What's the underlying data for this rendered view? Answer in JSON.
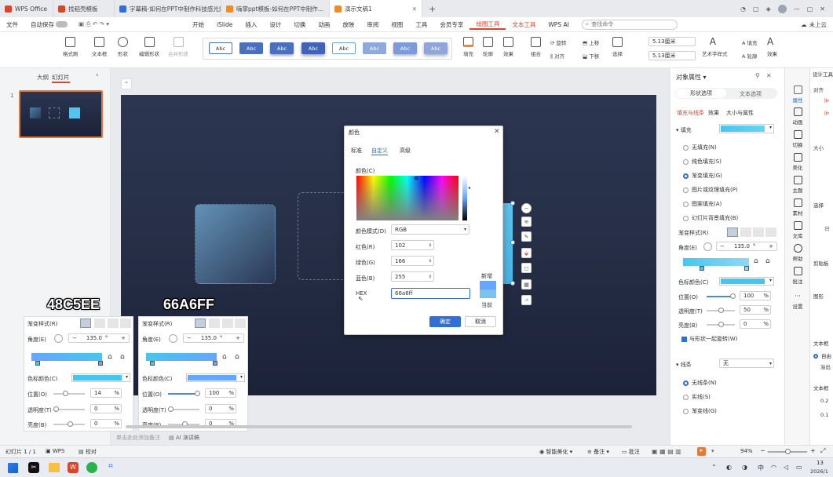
{
  "tabs": [
    {
      "label": "WPS Office",
      "color": "#d9472b"
    },
    {
      "label": "找稻壳模板",
      "color": "#d9472b"
    },
    {
      "label": "字幕稿-如何在PPT中制作科技感光效",
      "color": "#2f6fd6"
    },
    {
      "label": "嗨掌ppt模板-如何在PPT中制作...",
      "color": "#f08a24"
    },
    {
      "label": "演示文稿1",
      "color": "#f08a24"
    }
  ],
  "window": {
    "user": "未上云",
    "add_tab": "+"
  },
  "menubar": {
    "file": "文件",
    "autosave": "自动保存",
    "items": [
      "开始",
      "iSlide",
      "插入",
      "设计",
      "切换",
      "动画",
      "放映",
      "审阅",
      "视图",
      "工具",
      "会员专享",
      "绘图工具",
      "文本工具",
      "WPS AI"
    ],
    "search_placeholder": "查找命令"
  },
  "ribbon": {
    "format_brush": "格式刷",
    "textbox": "文本框",
    "shape": "形状",
    "edit_shape": "编辑形状",
    "merge_shape": "合并形状",
    "style_samples": [
      "Abc",
      "Abc",
      "Abc",
      "Abc",
      "Abc",
      "Abc",
      "Abc",
      "Abc"
    ],
    "fill": "填充",
    "outline": "轮廓",
    "effects": "效果",
    "group": "组合",
    "rotate": "旋转",
    "align": "对齐",
    "up": "上移",
    "down": "下移",
    "select": "选择",
    "height": "5.13厘米",
    "width": "5.13厘米",
    "art_style": "艺术字样式",
    "fill2": "填充",
    "outline2": "轮廓",
    "effects2": "效果"
  },
  "left_panel": {
    "outline_tab": "大纲",
    "slides_tab": "幻灯片",
    "slide_number": "1"
  },
  "overlay": {
    "label_a": "48C5EE",
    "label_b": "66A6FF"
  },
  "grad_panel_a": {
    "style": "渐变样式(R)",
    "angle_label": "角度(E)",
    "angle": "135.0",
    "unit": "°",
    "stop_color_label": "色标颜色(C)",
    "position_label": "位置(O)",
    "position": "14",
    "transparency_label": "透明度(T)",
    "transparency": "0",
    "brightness_label": "亮度(B)",
    "brightness": "0",
    "percent": "%",
    "minus": "−",
    "plus": "+"
  },
  "grad_panel_b": {
    "style": "渐变样式(R)",
    "angle_label": "角度(E)",
    "angle": "135.0",
    "unit": "°",
    "stop_color_label": "色标颜色(C)",
    "position_label": "位置(O)",
    "position": "100",
    "transparency_label": "透明度(T)",
    "transparency": "0",
    "brightness_label": "亮度(B)",
    "brightness": "0",
    "percent": "%",
    "minus": "−",
    "plus": "+"
  },
  "dialog": {
    "title": "颜色",
    "tabs": [
      "标准",
      "自定义",
      "高级"
    ],
    "color_label": "颜色(C)",
    "mode_label": "颜色模式(D)",
    "mode_value": "RGB",
    "red_label": "红色(R)",
    "red": "102",
    "green_label": "绿色(G)",
    "green": "166",
    "blue_label": "蓝色(B)",
    "blue": "255",
    "hex_label": "HEX",
    "hex": "66a6ff",
    "new_label": "新增",
    "current_label": "当前",
    "ok": "确定",
    "cancel": "取消",
    "new_color": "#66a6ff",
    "current_color": "#7cc2ee"
  },
  "right_panel": {
    "title": "对象属性",
    "tab_shape": "形状选项",
    "tab_text": "文本选项",
    "sub_fill_line": "填充与线条",
    "sub_effects": "效果",
    "sub_size": "大小与属性",
    "fill_label": "填充",
    "fill_options": [
      "无填充(N)",
      "纯色填充(S)",
      "渐变填充(G)",
      "图片或纹理填充(P)",
      "图案填充(A)",
      "幻灯片背景填充(B)"
    ],
    "grad_style": "渐变样式(R)",
    "angle_label": "角度(E)",
    "angle": "135.0",
    "unit": "°",
    "stop_color_label": "色标颜色(C)",
    "position_label": "位置(O)",
    "position": "100",
    "transparency_label": "透明度(T)",
    "transparency": "50",
    "brightness_label": "亮度(B)",
    "brightness": "0",
    "percent": "%",
    "rotate_with_shape": "与形状一起旋转(W)",
    "line_label": "线条",
    "line_value": "无",
    "line_options": [
      "无线条(N)",
      "实线(S)",
      "渐变线(G)"
    ],
    "minus": "−",
    "plus": "+"
  },
  "sidebar": [
    "属性",
    "动画",
    "切换",
    "美化",
    "主题",
    "素材",
    "文库",
    "帮助",
    "批注",
    "设置"
  ],
  "far_right": {
    "title": "设计工具",
    "items": [
      "对齐",
      "大小",
      "选择",
      "剪贴板",
      "图形",
      "文本框",
      "自由",
      "溢出",
      "文本框",
      "0.2",
      "0.1"
    ]
  },
  "status": {
    "slide_info": "幻灯片 1 / 1",
    "theme": "WPS",
    "proof": "校对",
    "notes_placeholder": "单击此处添加备注",
    "ai": "AI 演讲稿",
    "beautify": "智能美化",
    "notes": "备注",
    "comments": "批注",
    "zoom": "94%"
  },
  "taskbar": {
    "time": "13",
    "date": "2026/1",
    "lang": "中"
  }
}
